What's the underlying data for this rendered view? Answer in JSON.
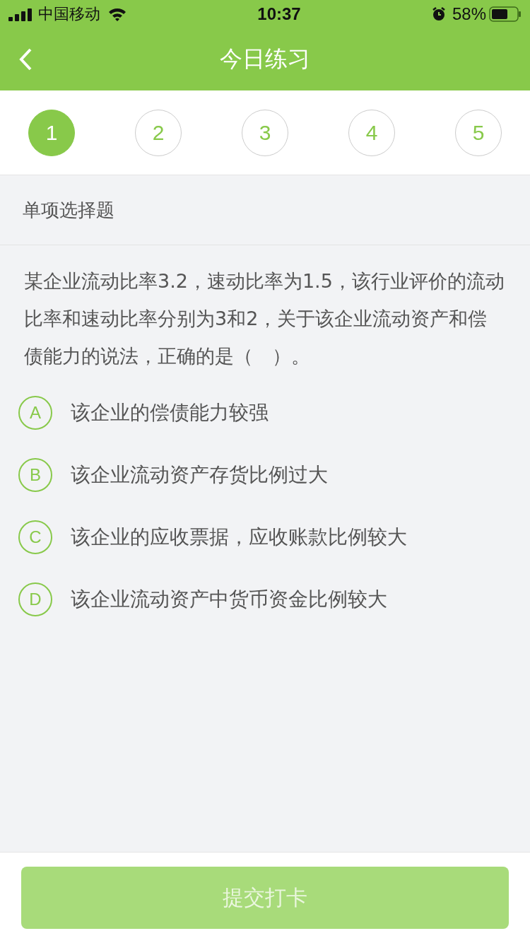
{
  "status_bar": {
    "carrier": "中国移动",
    "time": "10:37",
    "battery": "58%"
  },
  "nav": {
    "title": "今日练习"
  },
  "steps": [
    {
      "label": "1",
      "selected": true
    },
    {
      "label": "2",
      "selected": false
    },
    {
      "label": "3",
      "selected": false
    },
    {
      "label": "4",
      "selected": false
    },
    {
      "label": "5",
      "selected": false
    }
  ],
  "question": {
    "type": "单项选择题",
    "text": "某企业流动比率3.2，速动比率为1.5，该行业评价的流动比率和速动比率分别为3和2，关于该企业流动资产和偿债能力的说法，正确的是（　）。",
    "options": [
      {
        "letter": "A",
        "text": "该企业的偿债能力较强",
        "selected": false
      },
      {
        "letter": "B",
        "text": "该企业流动资产存货比例过大",
        "selected": false
      },
      {
        "letter": "C",
        "text": "该企业的应收票据，应收账款比例较大",
        "selected": false
      },
      {
        "letter": "D",
        "text": "该企业流动资产中货币资金比例较大",
        "selected": false
      }
    ]
  },
  "submit": {
    "label": "提交打卡",
    "disabled": true
  }
}
